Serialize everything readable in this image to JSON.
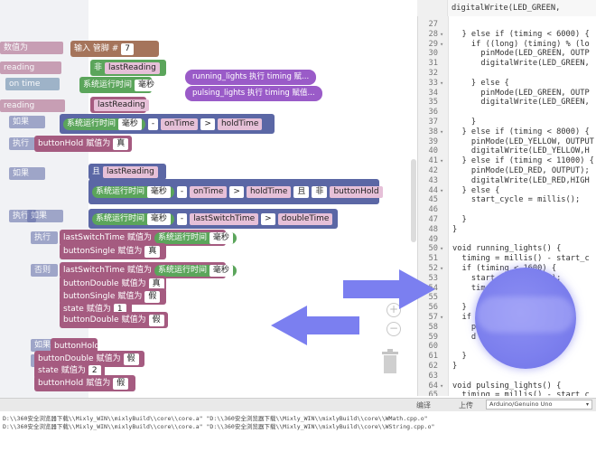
{
  "workspace": {
    "ghost_items": [
      "数值为",
      "reading",
      "millis",
      "on time",
      "reading",
      "如果",
      "执行",
      "如果",
      "执行",
      "如果",
      "执行",
      "执行",
      "如果",
      "否则",
      "如果",
      "执行"
    ],
    "blocks": {
      "header_label": "输入 管脚 #",
      "header_pin": "7",
      "not_label": "非",
      "last_reading_1": "lastReading",
      "sys_time_1": "系统运行时间",
      "ms_1": "毫秒",
      "last_reading_2": "lastReading",
      "sys_time_2": "系统运行时间",
      "ms_2": "毫秒",
      "minus_2": "-",
      "on_time_2": "onTime",
      "gt_2": ">",
      "hold_time_2": "holdTime",
      "button_hold_1": "buttonHold",
      "true_1": "真",
      "value_as": "赋值为",
      "and_label": "且",
      "last_reading_3": "lastReading",
      "sys_time_3": "系统运行时间",
      "ms_3": "毫秒",
      "minus_3": "-",
      "on_time_3": "onTime",
      "gt_3": ">",
      "hold_time_3": "holdTime",
      "and_3": "且",
      "not_3": "非",
      "button_hold_3": "buttonHold",
      "sys_time_4": "系统运行时间",
      "ms_4": "毫秒",
      "minus_4": "-",
      "last_switch_time_4": "lastSwitchTime",
      "gt_4": ">",
      "double_time_4": "doubleTime",
      "last_switch_5": "lastSwitchTime",
      "assign_5": "赋值为",
      "sys_time_5": "系统运行时间",
      "ms_5": "毫秒",
      "button_single_5": "buttonSingle",
      "assign_5b": "赋值为",
      "true_5": "真",
      "last_switch_6": "lastSwitchTime",
      "assign_6": "赋值为",
      "sys_time_6": "系统运行时间",
      "ms_6": "毫秒",
      "button_double_6": "buttonDouble",
      "assign_6b": "赋值为",
      "true_6": "真",
      "button_single_6": "buttonSingle",
      "assign_6c": "赋值为",
      "false_6": "假",
      "state_6": "state",
      "assign_6d": "赋值为",
      "one_6": "1",
      "button_double_7": "buttonDouble",
      "assign_7": "赋值为",
      "false_7": "假",
      "button_hold_8": "buttonHold",
      "button_double_8": "buttonDouble",
      "assign_8": "赋值为",
      "false_8": "假",
      "state_8": "state",
      "assign_8b": "赋值为",
      "two_8": "2",
      "button_hold_9": "buttonHold",
      "assign_9": "赋值为",
      "false_9": "假"
    },
    "comments": [
      "running_lights  执行 timing 赋...",
      "pulsing_lights  执行 timing 赋值..."
    ],
    "zoom_in": "+",
    "zoom_out": "−"
  },
  "editor": {
    "top_line": "digitalWrite(LED_GREEN,",
    "lines": [
      {
        "n": "27",
        "fold": "",
        "t": "  "
      },
      {
        "n": "28",
        "fold": "▾",
        "t": "  } else if (timing < 6000) {"
      },
      {
        "n": "29",
        "fold": "▾",
        "t": "    if ((long) (timing) % (lo"
      },
      {
        "n": "30",
        "fold": "",
        "t": "      pinMode(LED_GREEN, OUTP"
      },
      {
        "n": "31",
        "fold": "",
        "t": "      digitalWrite(LED_GREEN,"
      },
      {
        "n": "32",
        "fold": "",
        "t": ""
      },
      {
        "n": "33",
        "fold": "▾",
        "t": "    } else {"
      },
      {
        "n": "34",
        "fold": "",
        "t": "      pinMode(LED_GREEN, OUTP"
      },
      {
        "n": "35",
        "fold": "",
        "t": "      digitalWrite(LED_GREEN,"
      },
      {
        "n": "36",
        "fold": "",
        "t": ""
      },
      {
        "n": "37",
        "fold": "",
        "t": "    }"
      },
      {
        "n": "38",
        "fold": "▾",
        "t": "  } else if (timing < 8000) {"
      },
      {
        "n": "39",
        "fold": "",
        "t": "    pinMode(LED_YELLOW, OUTPUT"
      },
      {
        "n": "40",
        "fold": "",
        "t": "    digitalWrite(LED_YELLOW,H"
      },
      {
        "n": "41",
        "fold": "▾",
        "t": "  } else if (timing < 11000) {"
      },
      {
        "n": "42",
        "fold": "",
        "t": "    pinMode(LED_RED, OUTPUT);"
      },
      {
        "n": "43",
        "fold": "",
        "t": "    digitalWrite(LED_RED,HIGH"
      },
      {
        "n": "44",
        "fold": "▾",
        "t": "  } else {"
      },
      {
        "n": "45",
        "fold": "",
        "t": "    start_cycle = millis();"
      },
      {
        "n": "46",
        "fold": "",
        "t": ""
      },
      {
        "n": "47",
        "fold": "",
        "t": "  }"
      },
      {
        "n": "48",
        "fold": "",
        "t": "}"
      },
      {
        "n": "49",
        "fold": "",
        "t": ""
      },
      {
        "n": "50",
        "fold": "▾",
        "t": "void running_lights() {"
      },
      {
        "n": "51",
        "fold": "",
        "t": "  timing = millis() - start_c"
      },
      {
        "n": "52",
        "fold": "▾",
        "t": "  if (timing < 1600) {"
      },
      {
        "n": "53",
        "fold": "",
        "t": "    start_c = millis();"
      },
      {
        "n": "54",
        "fold": "",
        "t": "    tim"
      },
      {
        "n": "55",
        "fold": "",
        "t": ""
      },
      {
        "n": "56",
        "fold": "",
        "t": "  }"
      },
      {
        "n": "57",
        "fold": "▾",
        "t": "  if"
      },
      {
        "n": "58",
        "fold": "",
        "t": "    p              (tim"
      },
      {
        "n": "59",
        "fold": "",
        "t": "    d             [(int"
      },
      {
        "n": "60",
        "fold": "",
        "t": ""
      },
      {
        "n": "61",
        "fold": "",
        "t": "  }"
      },
      {
        "n": "62",
        "fold": "",
        "t": "}"
      },
      {
        "n": "63",
        "fold": "",
        "t": ""
      },
      {
        "n": "64",
        "fold": "▾",
        "t": "void pulsing_lights() {"
      },
      {
        "n": "65",
        "fold": "",
        "t": "  timing = millis() - start_c"
      }
    ]
  },
  "bottombar": {
    "compile": "编译",
    "upload": "上传",
    "board": "Arduino/Genuino Uno"
  },
  "console": {
    "line1": "D:\\\\360安全浏览器下载\\\\Mixly_WIN\\\\mixlyBuild\\\\core\\\\core.a\" \"D:\\\\360安全浏览器下载\\\\Mixly_WIN\\\\mixlyBuild\\\\core\\\\WMath.cpp.o\"",
    "line2": "D:\\\\360安全浏览器下载\\\\Mixly_WIN\\\\mixlyBuild\\\\core\\\\core.a\" \"D:\\\\360安全浏览器下载\\\\Mixly_WIN\\\\mixlyBuild\\\\core\\\\WString.cpp.o\""
  },
  "colors": {
    "arrow": "#7b7ff0",
    "blur": "#7d80ee"
  }
}
